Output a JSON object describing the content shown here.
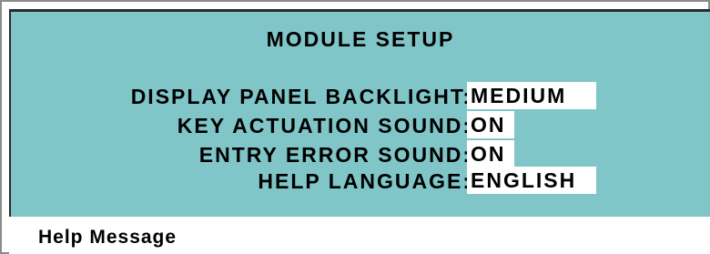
{
  "panel": {
    "title": "MODULE SETUP"
  },
  "settings": [
    {
      "label": "DISPLAY PANEL BACKLIGHT:",
      "value": "MEDIUM"
    },
    {
      "label": "KEY ACTUATION SOUND:",
      "value": "ON"
    },
    {
      "label": "ENTRY ERROR SOUND:",
      "value": "ON"
    },
    {
      "label": "HELP LANGUAGE:",
      "value": "ENGLISH"
    }
  ],
  "help": {
    "title": "Help Message"
  },
  "colors": {
    "panel_background": "#80c6c9",
    "value_background": "#ffffff",
    "text": "#000000"
  }
}
